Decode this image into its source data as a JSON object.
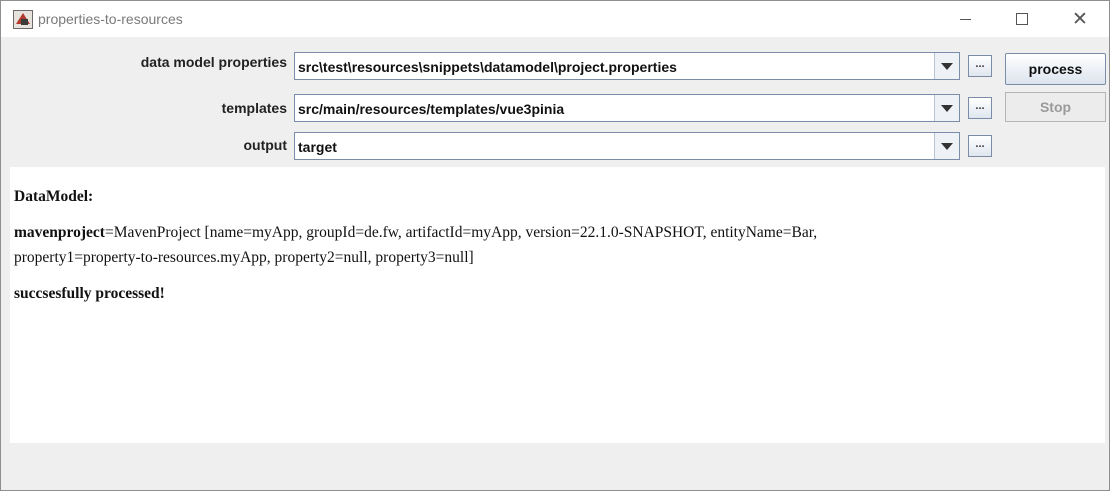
{
  "window": {
    "title": "properties-to-resources",
    "close_glyph": "✕"
  },
  "form": {
    "data_model_label": "data model properties",
    "data_model_value": "src\\test\\resources\\snippets\\datamodel\\project.properties",
    "templates_label": "templates",
    "templates_value": "src/main/resources/templates/vue3pinia",
    "output_label": "output",
    "output_value": "target",
    "browse_label": "..."
  },
  "buttons": {
    "process_label": "process",
    "stop_label": "Stop"
  },
  "output": {
    "heading": "DataModel:",
    "key": "mavenproject",
    "line1_rest": "=MavenProject [name=myApp, groupId=de.fw, artifactId=myApp, version=22.1.0-SNAPSHOT, entityName=Bar,",
    "line2": "property1=property-to-resources.myApp, property2=null, property3=null]",
    "status": "succsesfully processed!"
  },
  "icons": [
    "app-icon",
    "minimize-icon",
    "maximize-icon",
    "close-icon",
    "dropdown-arrow-icon"
  ]
}
